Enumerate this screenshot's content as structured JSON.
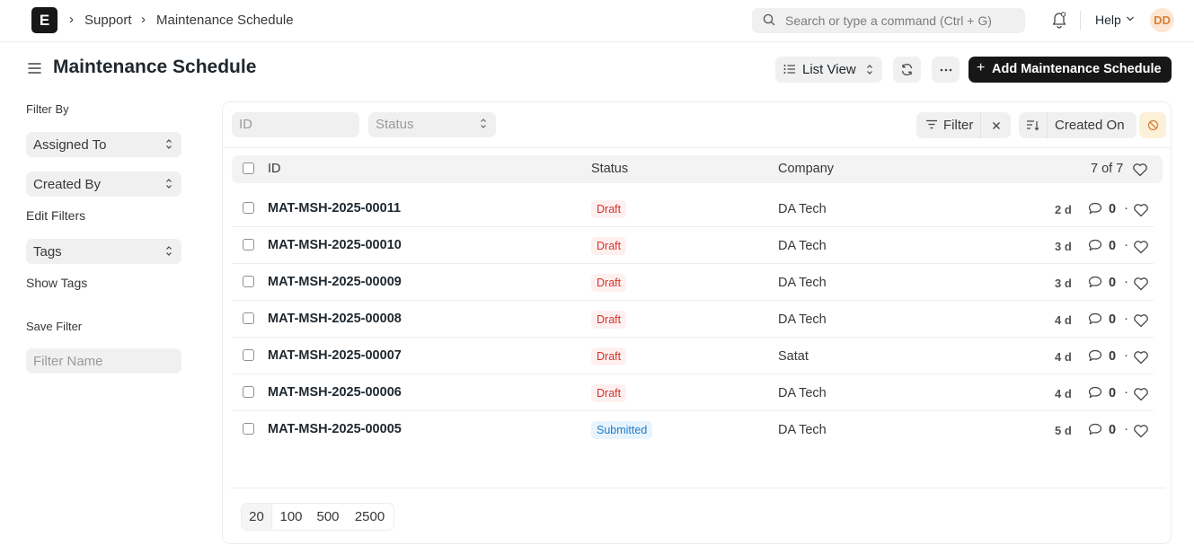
{
  "navbar": {
    "logo_letter": "E",
    "breadcrumbs": [
      "Support",
      "Maintenance Schedule"
    ],
    "search_placeholder": "Search or type a command (Ctrl + G)",
    "help_label": "Help",
    "avatar_initials": "DD"
  },
  "page": {
    "title": "Maintenance Schedule",
    "list_view_label": "List View",
    "add_button_label": "Add Maintenance Schedule"
  },
  "sidebar": {
    "filter_by_label": "Filter By",
    "assigned_to_label": "Assigned To",
    "created_by_label": "Created By",
    "edit_filters_label": "Edit Filters",
    "tags_label": "Tags",
    "show_tags_label": "Show Tags",
    "save_filter_label": "Save Filter",
    "filter_name_placeholder": "Filter Name"
  },
  "filters": {
    "id_placeholder": "ID",
    "status_placeholder": "Status",
    "filter_label": "Filter",
    "sort_label": "Created On"
  },
  "list": {
    "columns": [
      "ID",
      "Status",
      "Company"
    ],
    "count_label": "7 of 7",
    "rows": [
      {
        "id": "MAT-MSH-2025-00011",
        "status": "Draft",
        "company": "DA Tech",
        "age": "2 d",
        "comments": "0"
      },
      {
        "id": "MAT-MSH-2025-00010",
        "status": "Draft",
        "company": "DA Tech",
        "age": "3 d",
        "comments": "0"
      },
      {
        "id": "MAT-MSH-2025-00009",
        "status": "Draft",
        "company": "DA Tech",
        "age": "3 d",
        "comments": "0"
      },
      {
        "id": "MAT-MSH-2025-00008",
        "status": "Draft",
        "company": "DA Tech",
        "age": "4 d",
        "comments": "0"
      },
      {
        "id": "MAT-MSH-2025-00007",
        "status": "Draft",
        "company": "Satat",
        "age": "4 d",
        "comments": "0"
      },
      {
        "id": "MAT-MSH-2025-00006",
        "status": "Draft",
        "company": "DA Tech",
        "age": "4 d",
        "comments": "0"
      },
      {
        "id": "MAT-MSH-2025-00005",
        "status": "Submitted",
        "company": "DA Tech",
        "age": "5 d",
        "comments": "0"
      }
    ]
  },
  "paging": {
    "sizes": [
      "20",
      "100",
      "500",
      "2500"
    ]
  },
  "colors": {
    "draft": "#d4332b",
    "submitted": "#1f7cc9",
    "primary_button": "#171717"
  }
}
